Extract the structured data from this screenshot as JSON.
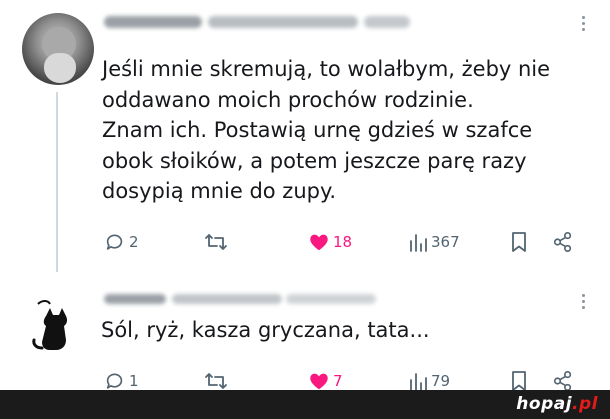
{
  "post": {
    "text_lines": [
      "Jeśli mnie skremują, to wolałbym, żeby nie",
      "oddawano moich prochów rodzinie.",
      "Znam ich. Postawią urnę gdzieś w szafce",
      "obok słoików, a potem jeszcze parę razy",
      "dosypią mnie do zupy."
    ],
    "replies": "2",
    "likes": "18",
    "views": "367"
  },
  "reply": {
    "text": "Sól, ryż, kasza gryczana, tata...",
    "replies": "1",
    "likes": "7",
    "views": "79"
  },
  "watermark": {
    "name": "hopaj",
    "dot": ".",
    "tld": "pl"
  },
  "colors": {
    "icon_gray": "#536471",
    "like_pink": "#f91880",
    "thread_line": "#cfd9de",
    "footer_bg": "#1b1b1b",
    "logo_red": "#e21b1b"
  },
  "icons": [
    "more-options-icon",
    "reply-icon",
    "repost-icon",
    "heart-filled-icon",
    "heart-outline-icon",
    "views-chart-icon",
    "bookmark-icon",
    "share-icon"
  ]
}
